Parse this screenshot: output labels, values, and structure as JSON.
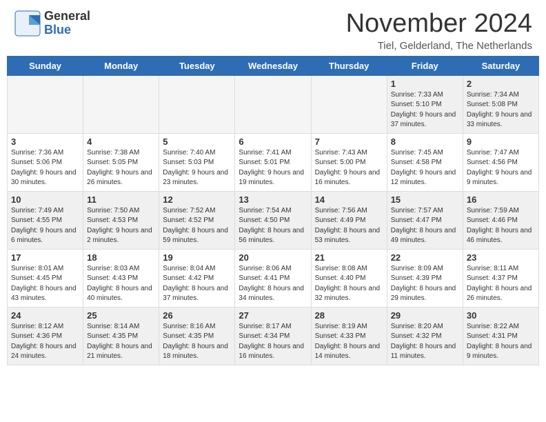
{
  "header": {
    "logo_general": "General",
    "logo_blue": "Blue",
    "month_title": "November 2024",
    "location": "Tiel, Gelderland, The Netherlands"
  },
  "weekdays": [
    "Sunday",
    "Monday",
    "Tuesday",
    "Wednesday",
    "Thursday",
    "Friday",
    "Saturday"
  ],
  "weeks": [
    [
      {
        "day": "",
        "info": ""
      },
      {
        "day": "",
        "info": ""
      },
      {
        "day": "",
        "info": ""
      },
      {
        "day": "",
        "info": ""
      },
      {
        "day": "",
        "info": ""
      },
      {
        "day": "1",
        "info": "Sunrise: 7:33 AM\nSunset: 5:10 PM\nDaylight: 9 hours and 37 minutes."
      },
      {
        "day": "2",
        "info": "Sunrise: 7:34 AM\nSunset: 5:08 PM\nDaylight: 9 hours and 33 minutes."
      }
    ],
    [
      {
        "day": "3",
        "info": "Sunrise: 7:36 AM\nSunset: 5:06 PM\nDaylight: 9 hours and 30 minutes."
      },
      {
        "day": "4",
        "info": "Sunrise: 7:38 AM\nSunset: 5:05 PM\nDaylight: 9 hours and 26 minutes."
      },
      {
        "day": "5",
        "info": "Sunrise: 7:40 AM\nSunset: 5:03 PM\nDaylight: 9 hours and 23 minutes."
      },
      {
        "day": "6",
        "info": "Sunrise: 7:41 AM\nSunset: 5:01 PM\nDaylight: 9 hours and 19 minutes."
      },
      {
        "day": "7",
        "info": "Sunrise: 7:43 AM\nSunset: 5:00 PM\nDaylight: 9 hours and 16 minutes."
      },
      {
        "day": "8",
        "info": "Sunrise: 7:45 AM\nSunset: 4:58 PM\nDaylight: 9 hours and 12 minutes."
      },
      {
        "day": "9",
        "info": "Sunrise: 7:47 AM\nSunset: 4:56 PM\nDaylight: 9 hours and 9 minutes."
      }
    ],
    [
      {
        "day": "10",
        "info": "Sunrise: 7:49 AM\nSunset: 4:55 PM\nDaylight: 9 hours and 6 minutes."
      },
      {
        "day": "11",
        "info": "Sunrise: 7:50 AM\nSunset: 4:53 PM\nDaylight: 9 hours and 2 minutes."
      },
      {
        "day": "12",
        "info": "Sunrise: 7:52 AM\nSunset: 4:52 PM\nDaylight: 8 hours and 59 minutes."
      },
      {
        "day": "13",
        "info": "Sunrise: 7:54 AM\nSunset: 4:50 PM\nDaylight: 8 hours and 56 minutes."
      },
      {
        "day": "14",
        "info": "Sunrise: 7:56 AM\nSunset: 4:49 PM\nDaylight: 8 hours and 53 minutes."
      },
      {
        "day": "15",
        "info": "Sunrise: 7:57 AM\nSunset: 4:47 PM\nDaylight: 8 hours and 49 minutes."
      },
      {
        "day": "16",
        "info": "Sunrise: 7:59 AM\nSunset: 4:46 PM\nDaylight: 8 hours and 46 minutes."
      }
    ],
    [
      {
        "day": "17",
        "info": "Sunrise: 8:01 AM\nSunset: 4:45 PM\nDaylight: 8 hours and 43 minutes."
      },
      {
        "day": "18",
        "info": "Sunrise: 8:03 AM\nSunset: 4:43 PM\nDaylight: 8 hours and 40 minutes."
      },
      {
        "day": "19",
        "info": "Sunrise: 8:04 AM\nSunset: 4:42 PM\nDaylight: 8 hours and 37 minutes."
      },
      {
        "day": "20",
        "info": "Sunrise: 8:06 AM\nSunset: 4:41 PM\nDaylight: 8 hours and 34 minutes."
      },
      {
        "day": "21",
        "info": "Sunrise: 8:08 AM\nSunset: 4:40 PM\nDaylight: 8 hours and 32 minutes."
      },
      {
        "day": "22",
        "info": "Sunrise: 8:09 AM\nSunset: 4:39 PM\nDaylight: 8 hours and 29 minutes."
      },
      {
        "day": "23",
        "info": "Sunrise: 8:11 AM\nSunset: 4:37 PM\nDaylight: 8 hours and 26 minutes."
      }
    ],
    [
      {
        "day": "24",
        "info": "Sunrise: 8:12 AM\nSunset: 4:36 PM\nDaylight: 8 hours and 24 minutes."
      },
      {
        "day": "25",
        "info": "Sunrise: 8:14 AM\nSunset: 4:35 PM\nDaylight: 8 hours and 21 minutes."
      },
      {
        "day": "26",
        "info": "Sunrise: 8:16 AM\nSunset: 4:35 PM\nDaylight: 8 hours and 18 minutes."
      },
      {
        "day": "27",
        "info": "Sunrise: 8:17 AM\nSunset: 4:34 PM\nDaylight: 8 hours and 16 minutes."
      },
      {
        "day": "28",
        "info": "Sunrise: 8:19 AM\nSunset: 4:33 PM\nDaylight: 8 hours and 14 minutes."
      },
      {
        "day": "29",
        "info": "Sunrise: 8:20 AM\nSunset: 4:32 PM\nDaylight: 8 hours and 11 minutes."
      },
      {
        "day": "30",
        "info": "Sunrise: 8:22 AM\nSunset: 4:31 PM\nDaylight: 8 hours and 9 minutes."
      }
    ]
  ]
}
